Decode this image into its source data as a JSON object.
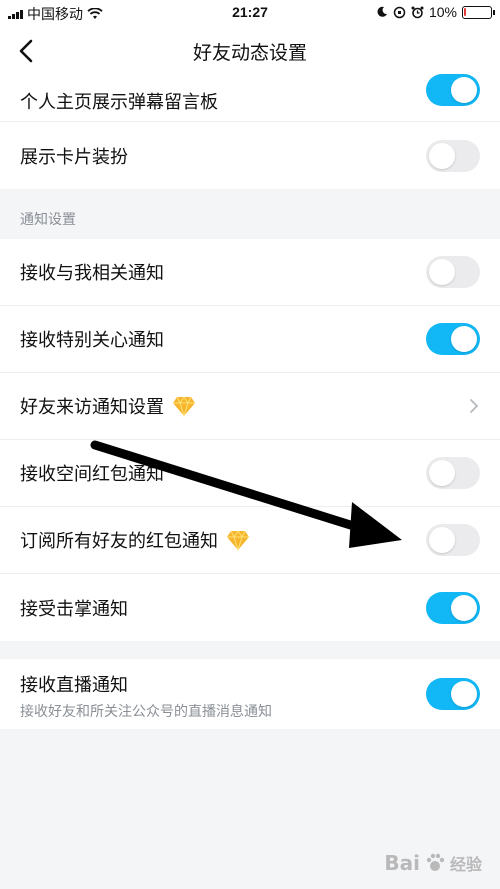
{
  "status_bar": {
    "carrier": "中国移动",
    "time": "21:27",
    "battery_percent": "10%",
    "battery_level": 0.1,
    "colors": {
      "battery_low": "#e53935"
    }
  },
  "nav": {
    "title": "好友动态设置",
    "back_icon": "chevron-left-icon"
  },
  "rows_top": [
    {
      "label": "个人主页展示弹幕留言板",
      "toggle_on": true
    },
    {
      "label": "展示卡片装扮",
      "toggle_on": false
    }
  ],
  "section_notify": {
    "header": "通知设置",
    "rows": [
      {
        "label": "接收与我相关通知",
        "toggle_on": false
      },
      {
        "label": "接收特别关心通知",
        "toggle_on": true
      },
      {
        "label": "好友来访通知设置",
        "has_gem": true,
        "chevron": true
      },
      {
        "label": "接收空间红包通知",
        "toggle_on": false
      },
      {
        "label": "订阅所有好友的红包通知",
        "has_gem": true,
        "toggle_on": false
      },
      {
        "label": "接受击掌通知",
        "toggle_on": true
      }
    ]
  },
  "live": {
    "title": "接收直播通知",
    "subtitle": "接收好友和所关注公众号的直播消息通知",
    "toggle_on": true
  },
  "watermark": {
    "text": "Bai",
    "text2": "经验"
  },
  "colors": {
    "accent": "#12b7f5",
    "toggle_off": "#ebebee",
    "background": "#f4f5f7"
  }
}
